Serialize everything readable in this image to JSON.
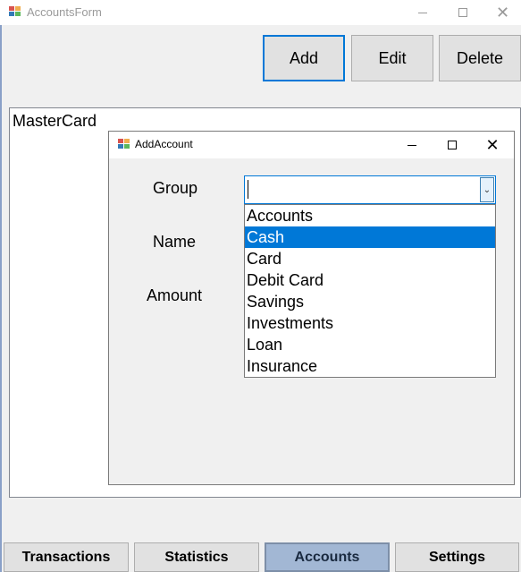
{
  "outer_window": {
    "title": "AccountsForm"
  },
  "toolbar": {
    "add_label": "Add",
    "edit_label": "Edit",
    "delete_label": "Delete"
  },
  "accounts_list": {
    "items": [
      "MasterCard"
    ]
  },
  "dialog": {
    "title": "AddAccount",
    "labels": {
      "group": "Group",
      "name": "Name",
      "amount": "Amount"
    },
    "group_combo": {
      "value": "",
      "options": [
        "Accounts",
        "Cash",
        "Card",
        "Debit Card",
        "Savings",
        "Investments",
        "Loan",
        "Insurance"
      ],
      "highlighted": "Cash"
    }
  },
  "tabs": [
    {
      "label": "Transactions",
      "active": false
    },
    {
      "label": "Statistics",
      "active": false
    },
    {
      "label": "Accounts",
      "active": true
    },
    {
      "label": "Settings",
      "active": false
    }
  ],
  "colors": {
    "accent": "#0078d7",
    "active_tab": "#a2b7d4"
  }
}
